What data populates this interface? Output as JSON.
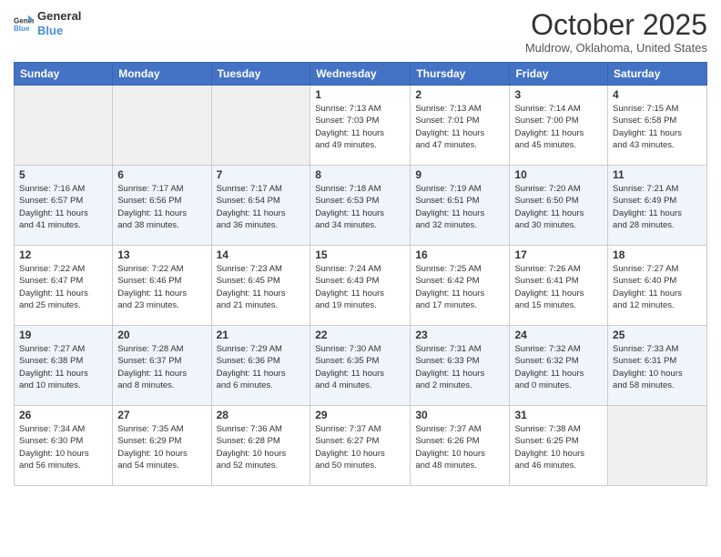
{
  "logo": {
    "line1": "General",
    "line2": "Blue"
  },
  "title": "October 2025",
  "location": "Muldrow, Oklahoma, United States",
  "days_header": [
    "Sunday",
    "Monday",
    "Tuesday",
    "Wednesday",
    "Thursday",
    "Friday",
    "Saturday"
  ],
  "weeks": [
    [
      {
        "num": "",
        "info": ""
      },
      {
        "num": "",
        "info": ""
      },
      {
        "num": "",
        "info": ""
      },
      {
        "num": "1",
        "info": "Sunrise: 7:13 AM\nSunset: 7:03 PM\nDaylight: 11 hours\nand 49 minutes."
      },
      {
        "num": "2",
        "info": "Sunrise: 7:13 AM\nSunset: 7:01 PM\nDaylight: 11 hours\nand 47 minutes."
      },
      {
        "num": "3",
        "info": "Sunrise: 7:14 AM\nSunset: 7:00 PM\nDaylight: 11 hours\nand 45 minutes."
      },
      {
        "num": "4",
        "info": "Sunrise: 7:15 AM\nSunset: 6:58 PM\nDaylight: 11 hours\nand 43 minutes."
      }
    ],
    [
      {
        "num": "5",
        "info": "Sunrise: 7:16 AM\nSunset: 6:57 PM\nDaylight: 11 hours\nand 41 minutes."
      },
      {
        "num": "6",
        "info": "Sunrise: 7:17 AM\nSunset: 6:56 PM\nDaylight: 11 hours\nand 38 minutes."
      },
      {
        "num": "7",
        "info": "Sunrise: 7:17 AM\nSunset: 6:54 PM\nDaylight: 11 hours\nand 36 minutes."
      },
      {
        "num": "8",
        "info": "Sunrise: 7:18 AM\nSunset: 6:53 PM\nDaylight: 11 hours\nand 34 minutes."
      },
      {
        "num": "9",
        "info": "Sunrise: 7:19 AM\nSunset: 6:51 PM\nDaylight: 11 hours\nand 32 minutes."
      },
      {
        "num": "10",
        "info": "Sunrise: 7:20 AM\nSunset: 6:50 PM\nDaylight: 11 hours\nand 30 minutes."
      },
      {
        "num": "11",
        "info": "Sunrise: 7:21 AM\nSunset: 6:49 PM\nDaylight: 11 hours\nand 28 minutes."
      }
    ],
    [
      {
        "num": "12",
        "info": "Sunrise: 7:22 AM\nSunset: 6:47 PM\nDaylight: 11 hours\nand 25 minutes."
      },
      {
        "num": "13",
        "info": "Sunrise: 7:22 AM\nSunset: 6:46 PM\nDaylight: 11 hours\nand 23 minutes."
      },
      {
        "num": "14",
        "info": "Sunrise: 7:23 AM\nSunset: 6:45 PM\nDaylight: 11 hours\nand 21 minutes."
      },
      {
        "num": "15",
        "info": "Sunrise: 7:24 AM\nSunset: 6:43 PM\nDaylight: 11 hours\nand 19 minutes."
      },
      {
        "num": "16",
        "info": "Sunrise: 7:25 AM\nSunset: 6:42 PM\nDaylight: 11 hours\nand 17 minutes."
      },
      {
        "num": "17",
        "info": "Sunrise: 7:26 AM\nSunset: 6:41 PM\nDaylight: 11 hours\nand 15 minutes."
      },
      {
        "num": "18",
        "info": "Sunrise: 7:27 AM\nSunset: 6:40 PM\nDaylight: 11 hours\nand 12 minutes."
      }
    ],
    [
      {
        "num": "19",
        "info": "Sunrise: 7:27 AM\nSunset: 6:38 PM\nDaylight: 11 hours\nand 10 minutes."
      },
      {
        "num": "20",
        "info": "Sunrise: 7:28 AM\nSunset: 6:37 PM\nDaylight: 11 hours\nand 8 minutes."
      },
      {
        "num": "21",
        "info": "Sunrise: 7:29 AM\nSunset: 6:36 PM\nDaylight: 11 hours\nand 6 minutes."
      },
      {
        "num": "22",
        "info": "Sunrise: 7:30 AM\nSunset: 6:35 PM\nDaylight: 11 hours\nand 4 minutes."
      },
      {
        "num": "23",
        "info": "Sunrise: 7:31 AM\nSunset: 6:33 PM\nDaylight: 11 hours\nand 2 minutes."
      },
      {
        "num": "24",
        "info": "Sunrise: 7:32 AM\nSunset: 6:32 PM\nDaylight: 11 hours\nand 0 minutes."
      },
      {
        "num": "25",
        "info": "Sunrise: 7:33 AM\nSunset: 6:31 PM\nDaylight: 10 hours\nand 58 minutes."
      }
    ],
    [
      {
        "num": "26",
        "info": "Sunrise: 7:34 AM\nSunset: 6:30 PM\nDaylight: 10 hours\nand 56 minutes."
      },
      {
        "num": "27",
        "info": "Sunrise: 7:35 AM\nSunset: 6:29 PM\nDaylight: 10 hours\nand 54 minutes."
      },
      {
        "num": "28",
        "info": "Sunrise: 7:36 AM\nSunset: 6:28 PM\nDaylight: 10 hours\nand 52 minutes."
      },
      {
        "num": "29",
        "info": "Sunrise: 7:37 AM\nSunset: 6:27 PM\nDaylight: 10 hours\nand 50 minutes."
      },
      {
        "num": "30",
        "info": "Sunrise: 7:37 AM\nSunset: 6:26 PM\nDaylight: 10 hours\nand 48 minutes."
      },
      {
        "num": "31",
        "info": "Sunrise: 7:38 AM\nSunset: 6:25 PM\nDaylight: 10 hours\nand 46 minutes."
      },
      {
        "num": "",
        "info": ""
      }
    ]
  ]
}
